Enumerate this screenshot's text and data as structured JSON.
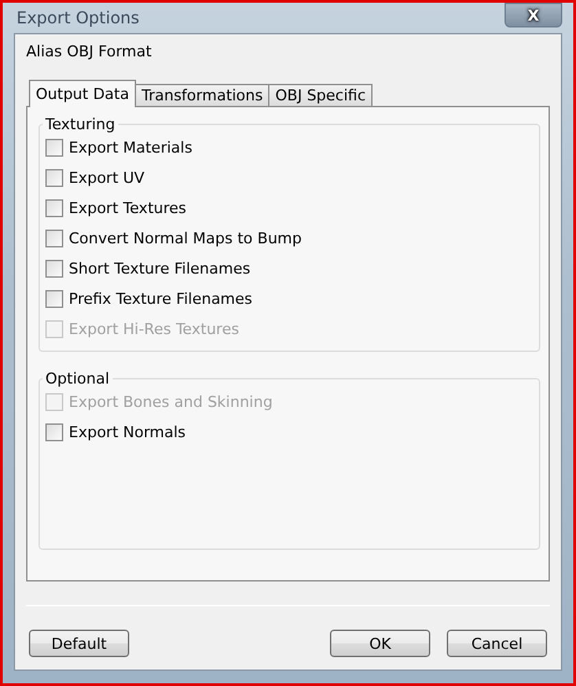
{
  "window": {
    "title": "Export Options",
    "close": "X"
  },
  "format_label": "Alias OBJ Format",
  "tabs": [
    {
      "label": "Output Data",
      "selected": true
    },
    {
      "label": "Transformations",
      "selected": false
    },
    {
      "label": "OBJ Specific",
      "selected": false
    }
  ],
  "groups": [
    {
      "title": "Texturing",
      "options": [
        {
          "label": "Export Materials",
          "checked": false,
          "disabled": false
        },
        {
          "label": "Export UV",
          "checked": false,
          "disabled": false
        },
        {
          "label": "Export Textures",
          "checked": false,
          "disabled": false
        },
        {
          "label": "Convert Normal Maps to Bump",
          "checked": false,
          "disabled": false
        },
        {
          "label": "Short Texture Filenames",
          "checked": false,
          "disabled": false
        },
        {
          "label": "Prefix Texture Filenames",
          "checked": false,
          "disabled": false
        },
        {
          "label": "Export Hi-Res Textures",
          "checked": false,
          "disabled": true
        }
      ]
    },
    {
      "title": "Optional",
      "options": [
        {
          "label": "Export Bones and Skinning",
          "checked": false,
          "disabled": true
        },
        {
          "label": "Export Normals",
          "checked": false,
          "disabled": false
        }
      ]
    }
  ],
  "buttons": {
    "left": [
      "Default"
    ],
    "right": [
      "OK",
      "Cancel"
    ]
  }
}
